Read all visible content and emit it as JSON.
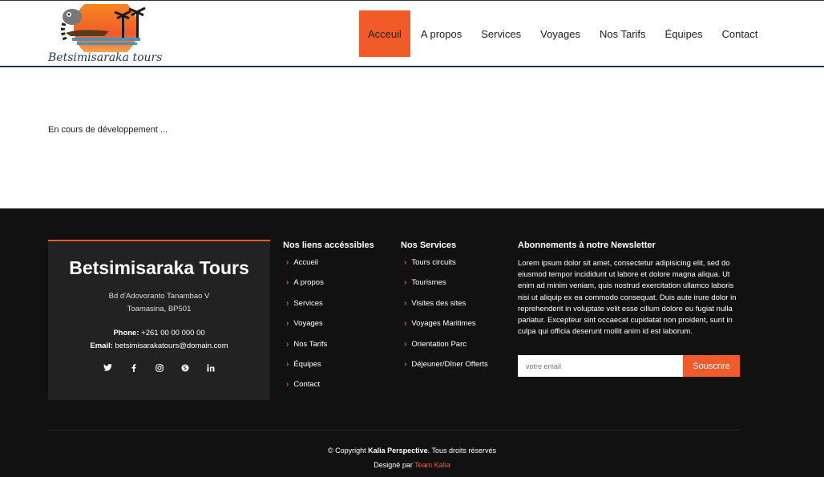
{
  "brand": {
    "logo_text": "Betsimisaraka tours"
  },
  "nav": {
    "items": [
      "Acceuil",
      "A propos",
      "Services",
      "Voyages",
      "Nos Tarifs",
      "Équipes",
      "Contact"
    ],
    "active": "Acceuil",
    "accent_color": "#f15a29"
  },
  "main": {
    "message": "En cours de développement ..."
  },
  "footer": {
    "card": {
      "title": "Betsimisaraka Tours",
      "address_line1": "Bd d'Adovoranto Tanambao V",
      "address_line2": "Toamasina, BP501",
      "phone_label": "Phone:",
      "phone_value": "+261 00 00 000 00",
      "email_label": "Email:",
      "email_value": "betsimisarakatours@domain.com",
      "socials": [
        "twitter-icon",
        "facebook-icon",
        "instagram-icon",
        "skype-icon",
        "linkedin-icon"
      ]
    },
    "links": {
      "title": "Nos liens accéssibles",
      "items": [
        "Accueil",
        "A propos",
        "Services",
        "Voyages",
        "Nos Tarifs",
        "Équipes",
        "Contact"
      ]
    },
    "services": {
      "title": "Nos Services",
      "items": [
        "Tours circuits",
        "Tourismes",
        "Visites des sites",
        "Voyages Maritimes",
        "Orientation Parc",
        "Déjeuner/Dîner Offerts"
      ]
    },
    "newsletter": {
      "title": "Abonnements à notre Newsletter",
      "text": "Lorem ipsum dolor sit amet, consectetur adipisicing elit, sed do eiusmod tempor incididunt ut labore et dolore magna aliqua. Ut enim ad minim veniam, quis nostrud exercitation ullamco laboris nisi ut aliquip ex ea commodo consequat. Duis aute irure dolor in reprehenderit in voluptate velit esse cillum dolore eu fugiat nulla pariatur. Excepteur sint occaecat cupidatat non proident, sunt in culpa qui officia deserunt mollit anim id est laborum.",
      "placeholder": "votre email",
      "button": "Souscrire"
    },
    "copyright": {
      "prefix": "© Copyright",
      "company": "Kalia Perspective",
      "suffix": ". Tous droits réservés"
    },
    "design": {
      "prefix": "Designé par",
      "team": "Team Kalia"
    }
  }
}
